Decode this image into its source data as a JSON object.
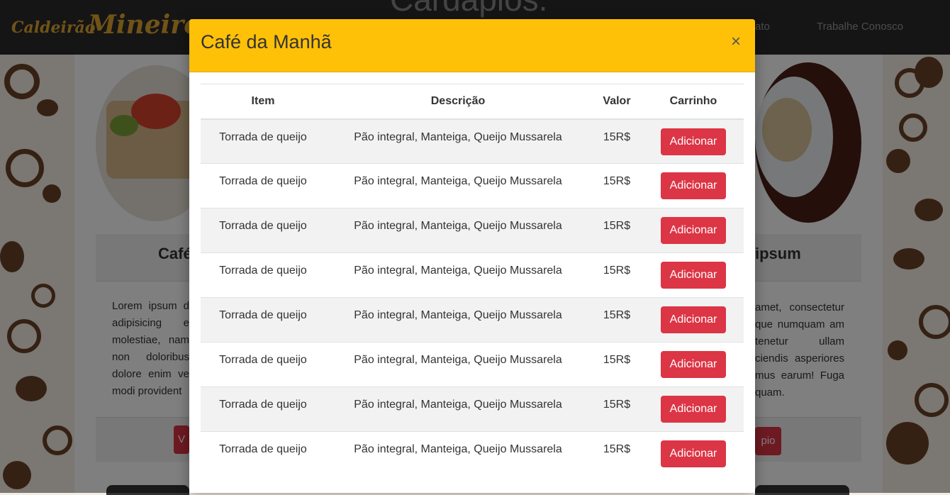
{
  "background": {
    "brand_small": "Caldeirão",
    "brand_big": "Mineiro",
    "nav": [
      "ato",
      "Trabalhe Conosco"
    ],
    "page_heading": "Cardápios.",
    "left_card": {
      "title_fragment": "Café",
      "text": "Lorem ipsum d adipisicing e molestiae, nam non doloribus dolore enim ve modi provident",
      "button_fragment": "V"
    },
    "right_card": {
      "title_fragment": "ipsum",
      "text": "amet, consectetur que numquam am tenetur ullam ciendis asperiores mus earum! Fuga quam.",
      "button_fragment": "pio"
    }
  },
  "modal": {
    "title": "Café da Manhã",
    "close_glyph": "×",
    "table": {
      "headers": [
        "Item",
        "Descrição",
        "Valor",
        "Carrinho"
      ],
      "rows": [
        {
          "item": "Torrada de queijo",
          "description": "Pão integral, Manteiga, Queijo Mussarela",
          "price": "15R$",
          "action": "Adicionar"
        },
        {
          "item": "Torrada de queijo",
          "description": "Pão integral, Manteiga, Queijo Mussarela",
          "price": "15R$",
          "action": "Adicionar"
        },
        {
          "item": "Torrada de queijo",
          "description": "Pão integral, Manteiga, Queijo Mussarela",
          "price": "15R$",
          "action": "Adicionar"
        },
        {
          "item": "Torrada de queijo",
          "description": "Pão integral, Manteiga, Queijo Mussarela",
          "price": "15R$",
          "action": "Adicionar"
        },
        {
          "item": "Torrada de queijo",
          "description": "Pão integral, Manteiga, Queijo Mussarela",
          "price": "15R$",
          "action": "Adicionar"
        },
        {
          "item": "Torrada de queijo",
          "description": "Pão integral, Manteiga, Queijo Mussarela",
          "price": "15R$",
          "action": "Adicionar"
        },
        {
          "item": "Torrada de queijo",
          "description": "Pão integral, Manteiga, Queijo Mussarela",
          "price": "15R$",
          "action": "Adicionar"
        },
        {
          "item": "Torrada de queijo",
          "description": "Pão integral, Manteiga, Queijo Mussarela",
          "price": "15R$",
          "action": "Adicionar"
        }
      ]
    }
  },
  "colors": {
    "modal_header": "#ffc107",
    "button_danger": "#dc3545",
    "brand": "#e2a72e",
    "topbar": "#2b2b2b",
    "pattern": "#6b4226"
  }
}
